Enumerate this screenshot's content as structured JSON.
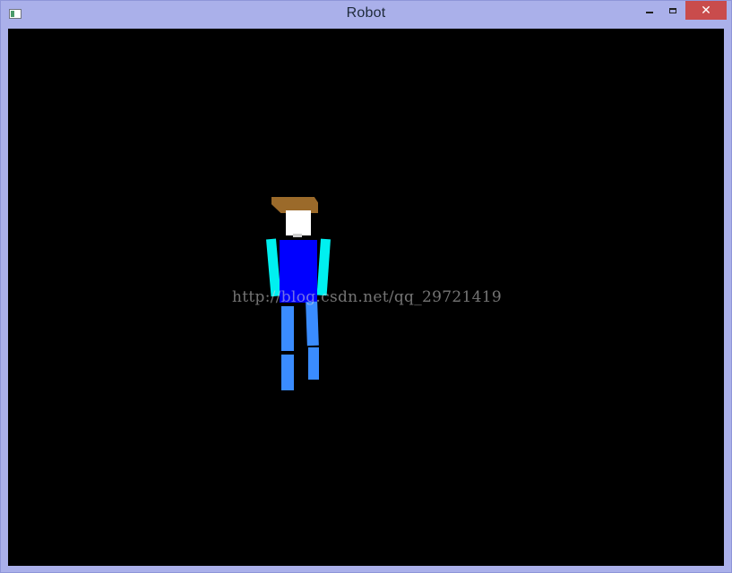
{
  "window": {
    "title": "Robot",
    "controls": {
      "close_glyph": "✕"
    }
  },
  "colors": {
    "hair": "#9b6a2a",
    "face": "#ffffff",
    "torso": "#0000ff",
    "arms": "#00f0f0",
    "legs": "#3a8cff",
    "background": "#000000"
  },
  "watermark": "http://blog.csdn.net/qq_29721419"
}
